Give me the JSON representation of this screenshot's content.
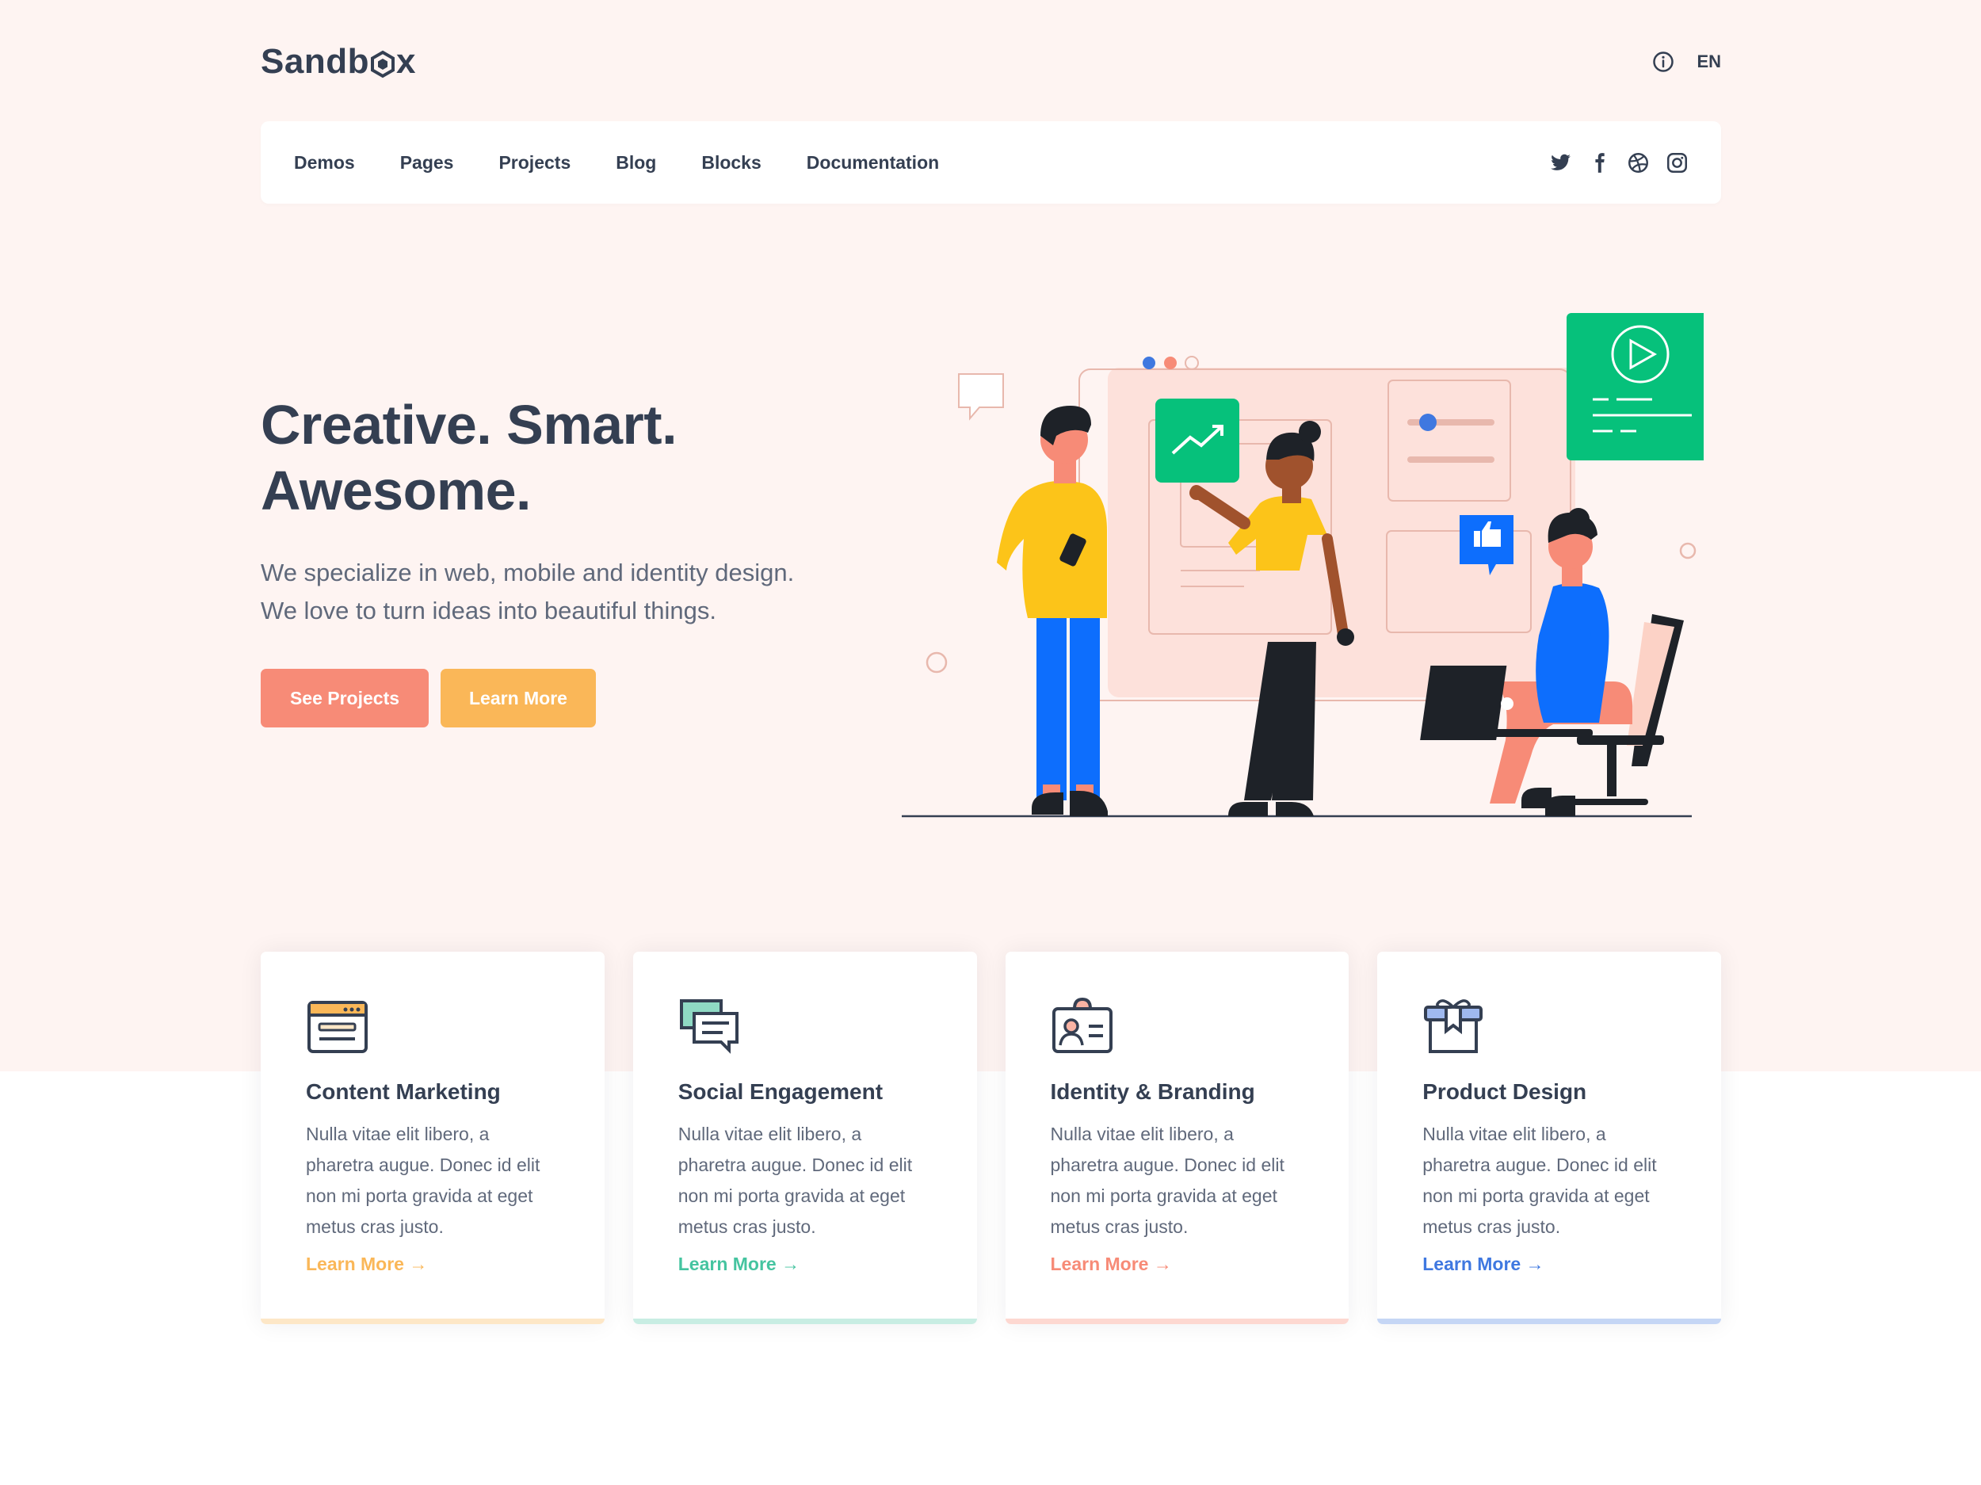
{
  "header": {
    "logo_prefix": "Sandb",
    "logo_suffix": "x",
    "language": "EN"
  },
  "nav": {
    "links": [
      "Demos",
      "Pages",
      "Projects",
      "Blog",
      "Blocks",
      "Documentation"
    ],
    "social_icons": [
      "twitter-icon",
      "facebook-icon",
      "dribbble-icon",
      "instagram-icon"
    ]
  },
  "hero": {
    "title_line1": "Creative. Smart.",
    "title_line2": "Awesome.",
    "subtitle_line1": "We specialize in web, mobile and identity design.",
    "subtitle_line2": "We love to turn ideas into beautiful things.",
    "primary_button": "See Projects",
    "secondary_button": "Learn More"
  },
  "cards": [
    {
      "title": "Content Marketing",
      "text": "Nulla vitae elit libero, a pharetra augue. Donec id elit non mi porta gravida at eget metus cras justo.",
      "link": "Learn More →",
      "color": "#fab758",
      "bar": "#fde7c7",
      "icon": "browser-window-icon"
    },
    {
      "title": "Social Engagement",
      "text": "Nulla vitae elit libero, a pharetra augue. Donec id elit non mi porta gravida at eget metus cras justo.",
      "link": "Learn More →",
      "color": "#45c4a0",
      "bar": "#c8ede3",
      "icon": "chat-bubbles-icon"
    },
    {
      "title": "Identity & Branding",
      "text": "Nulla vitae elit libero, a pharetra augue. Donec id elit non mi porta gravida at eget metus cras justo.",
      "link": "Learn More →",
      "color": "#f78b77",
      "bar": "#fdd8d1",
      "icon": "id-card-icon"
    },
    {
      "title": "Product Design",
      "text": "Nulla vitae elit libero, a pharetra augue. Donec id elit non mi porta gravida at eget metus cras justo.",
      "link": "Learn More →",
      "color": "#3f78e0",
      "bar": "#c5d6f5",
      "icon": "gift-box-icon"
    }
  ],
  "colors": {
    "hero_bg": "#fef4f2",
    "text_dark": "#343f52",
    "text_muted": "#60697b",
    "primary": "#f78b77",
    "secondary": "#fab758"
  }
}
